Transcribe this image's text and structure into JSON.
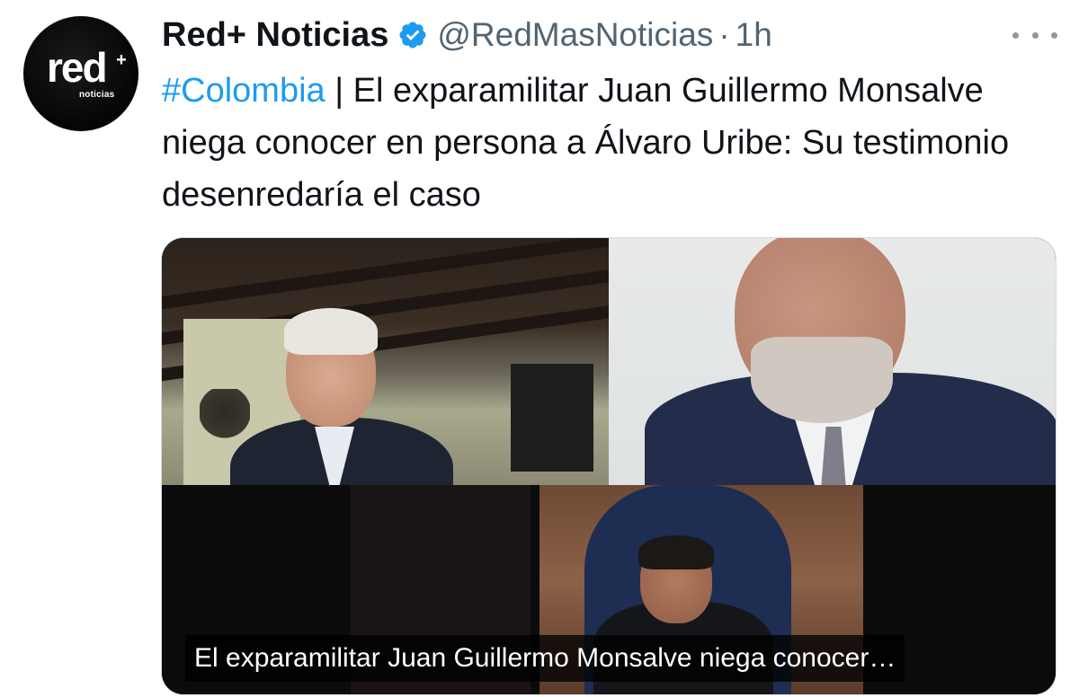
{
  "author": {
    "display_name": "Red+ Noticias",
    "handle": "@RedMasNoticias",
    "separator": "·",
    "timestamp": "1h",
    "verified_icon": "verified-badge-icon",
    "avatar": {
      "brand_word": "red",
      "brand_plus": "+",
      "brand_sub": "noticias"
    }
  },
  "post": {
    "hashtag": "#Colombia",
    "text_after_hashtag": " | El exparamilitar Juan Guillermo Monsalve niega conocer en persona a Álvaro Uribe: Su testimonio desenredaría el caso"
  },
  "media": {
    "caption": "El exparamilitar Juan Guillermo Monsalve niega conocer…"
  },
  "colors": {
    "hashtag": "#1d9bf0",
    "verified": "#1d9bf0",
    "text": "#0f1419",
    "secondary_text": "#536471"
  },
  "icons": {
    "more": "more-options-icon"
  }
}
